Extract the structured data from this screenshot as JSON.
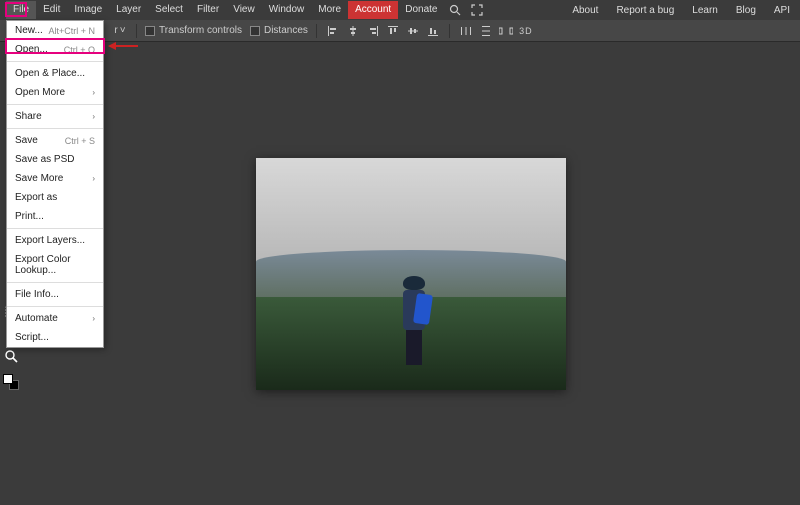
{
  "menubar": {
    "left": [
      "File",
      "Edit",
      "Image",
      "Layer",
      "Select",
      "Filter",
      "View",
      "Window",
      "More"
    ],
    "account": "Account",
    "donate": "Donate",
    "right": [
      "About",
      "Report a bug",
      "Learn",
      "Blog",
      "API"
    ]
  },
  "toolbar": {
    "transform_controls": "Transform controls",
    "distances": "Distances"
  },
  "file_menu": {
    "items": [
      {
        "label": "New...",
        "shortcut": "Alt+Ctrl + N"
      },
      {
        "label": "Open...",
        "shortcut": "Ctrl + O"
      },
      {
        "sep": true
      },
      {
        "label": "Open & Place..."
      },
      {
        "label": "Open More",
        "submenu": true
      },
      {
        "sep": true
      },
      {
        "label": "Share",
        "submenu": true
      },
      {
        "sep": true
      },
      {
        "label": "Save",
        "shortcut": "Ctrl + S"
      },
      {
        "label": "Save as PSD"
      },
      {
        "label": "Save More",
        "submenu": true
      },
      {
        "label": "Export as"
      },
      {
        "label": "Print..."
      },
      {
        "sep": true
      },
      {
        "label": "Export Layers..."
      },
      {
        "label": "Export Color Lookup..."
      },
      {
        "sep": true
      },
      {
        "label": "File Info..."
      },
      {
        "sep": true
      },
      {
        "label": "Automate",
        "submenu": true
      },
      {
        "label": "Script..."
      }
    ]
  }
}
